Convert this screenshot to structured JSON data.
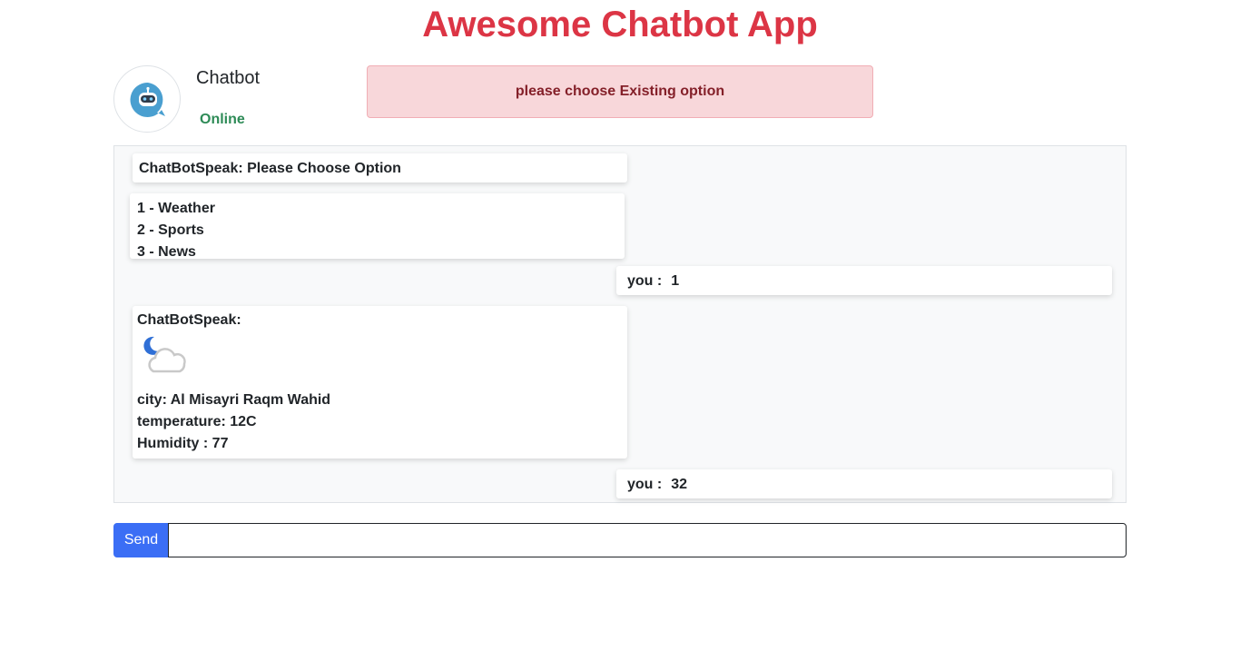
{
  "app": {
    "title": "Awesome Chatbot App"
  },
  "bot": {
    "name": "Chatbot",
    "status": "Online",
    "avatar_icon": "robot-chat-icon"
  },
  "alert": {
    "text": "please choose Existing option"
  },
  "messages": {
    "greeting": "ChatBotSpeak: Please Choose Option",
    "options": [
      "1 - Weather",
      "2 - Sports",
      "3 - News"
    ],
    "user1": {
      "prefix": "you :",
      "text": "1"
    },
    "weather": {
      "header": "ChatBotSpeak:",
      "icon": "night-cloudy-icon",
      "city": "city: Al Misayri Raqm Wahid",
      "temperature": "temperature: 12C",
      "humidity": "Humidity : 77"
    },
    "user2": {
      "prefix": "you :",
      "text": "32"
    }
  },
  "composer": {
    "send_label": "Send",
    "input_value": "",
    "input_placeholder": ""
  },
  "colors": {
    "title": "#dc3545",
    "online": "#2e8b57",
    "alert_bg": "#f8d7da",
    "alert_text": "#842029",
    "send_button": "#3b6ef5"
  }
}
